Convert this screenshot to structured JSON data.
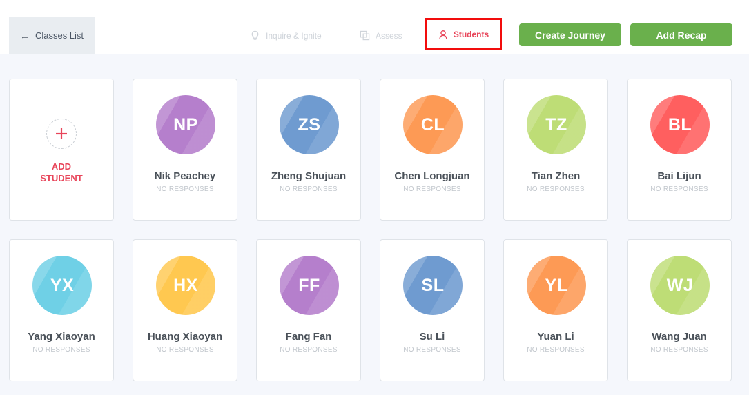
{
  "nav": {
    "back_label": "Classes List",
    "inquire_label": "Inquire & Ignite",
    "assess_label": "Assess",
    "students_label": "Students",
    "create_journey_label": "Create Journey",
    "add_recap_label": "Add Recap"
  },
  "add_student": {
    "label": "ADD\nSTUDENT",
    "icon": "plus-icon",
    "color": "#e8455a"
  },
  "students": [
    {
      "initials": "NP",
      "name": "Nik Peachey",
      "status": "NO RESPONSES",
      "color": "#b57fcc"
    },
    {
      "initials": "ZS",
      "name": "Zheng Shujuan",
      "status": "NO RESPONSES",
      "color": "#6f9bd0"
    },
    {
      "initials": "CL",
      "name": "Chen Longjuan",
      "status": "NO RESPONSES",
      "color": "#fd9a55"
    },
    {
      "initials": "TZ",
      "name": "Tian Zhen",
      "status": "NO RESPONSES",
      "color": "#bedd76"
    },
    {
      "initials": "BL",
      "name": "Bai Lijun",
      "status": "NO RESPONSES",
      "color": "#ff5f5f"
    },
    {
      "initials": "YX",
      "name": "Yang Xiaoyan",
      "status": "NO RESPONSES",
      "color": "#6fd0e6"
    },
    {
      "initials": "HX",
      "name": "Huang Xiaoyan",
      "status": "NO RESPONSES",
      "color": "#ffc850"
    },
    {
      "initials": "FF",
      "name": "Fang Fan",
      "status": "NO RESPONSES",
      "color": "#b57fcc"
    },
    {
      "initials": "SL",
      "name": "Su Li",
      "status": "NO RESPONSES",
      "color": "#6f9bd0"
    },
    {
      "initials": "YL",
      "name": "Yuan Li",
      "status": "NO RESPONSES",
      "color": "#fd9a55"
    },
    {
      "initials": "WJ",
      "name": "Wang Juan",
      "status": "NO RESPONSES",
      "color": "#bedd76"
    }
  ],
  "colors": {
    "accent": "#e8455a",
    "green": "#6ab04c",
    "highlight_box": "#f20d0d"
  }
}
